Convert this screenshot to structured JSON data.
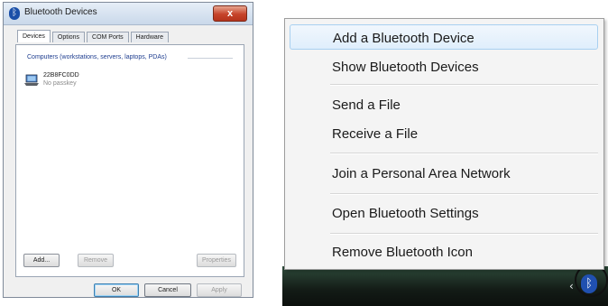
{
  "dialog": {
    "title": "Bluetooth Devices",
    "close_label": "x",
    "tabs": [
      {
        "label": "Devices",
        "active": true
      },
      {
        "label": "Options",
        "active": false
      },
      {
        "label": "COM Ports",
        "active": false
      },
      {
        "label": "Hardware",
        "active": false
      }
    ],
    "group_label": "Computers (workstations, servers, laptops, PDAs)",
    "device": {
      "name": "22B8FC0DD",
      "status": "No passkey",
      "icon": "computer-icon"
    },
    "buttons": {
      "add": "Add...",
      "remove": "Remove",
      "properties": "Properties"
    },
    "footer": {
      "ok": "OK",
      "cancel": "Cancel",
      "apply": "Apply"
    }
  },
  "menu": {
    "items": [
      "Add a Bluetooth Device",
      "Show Bluetooth Devices",
      "Send a File",
      "Receive a File",
      "Join a Personal Area Network",
      "Open Bluetooth Settings",
      "Remove Bluetooth Icon"
    ],
    "highlighted_index": 0
  },
  "taskbar": {
    "expand_icon": "chevron-left-icon",
    "tray_icon": "bluetooth-icon",
    "highlight_color": "#111111"
  },
  "colors": {
    "group_label": "#1e3d8f",
    "close_button": "#c6432a",
    "menu_hover_border": "#a8d0f0",
    "bluetooth_blue": "#2050b0"
  }
}
